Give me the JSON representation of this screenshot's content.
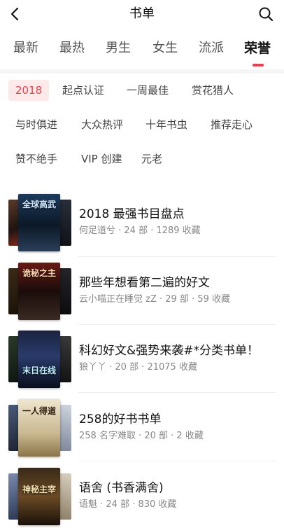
{
  "header": {
    "title": "书单",
    "back_icon": "chevron-left-icon",
    "search_icon": "search-icon"
  },
  "tabs": [
    {
      "label": "最新",
      "active": false
    },
    {
      "label": "最热",
      "active": false
    },
    {
      "label": "男生",
      "active": false
    },
    {
      "label": "女生",
      "active": false
    },
    {
      "label": "流派",
      "active": false
    },
    {
      "label": "荣誉",
      "active": true
    }
  ],
  "accent_color": "#e8414b",
  "filters": [
    {
      "label": "2018",
      "active": true
    },
    {
      "label": "起点认证",
      "active": false
    },
    {
      "label": "一周最佳",
      "active": false
    },
    {
      "label": "赏花猎人",
      "active": false
    },
    {
      "label": "与时俱进",
      "active": false
    },
    {
      "label": "大众热评",
      "active": false
    },
    {
      "label": "十年书虫",
      "active": false
    },
    {
      "label": "推荐走心",
      "active": false
    },
    {
      "label": "赞不绝手",
      "active": false
    },
    {
      "label": "VIP 创建",
      "active": false
    },
    {
      "label": "元老",
      "active": false
    }
  ],
  "booklists": [
    {
      "title": "2018 最强书目盘点",
      "meta": "何足道兮 · 24 部 · 1289 收藏",
      "cover_text": "全球高武"
    },
    {
      "title": "那些年想看第二遍的好文",
      "meta": "云小喵正在睡觉 zZ · 29 部 · 59 收藏",
      "cover_text": "诡秘之主"
    },
    {
      "title": "科幻好文&强势来袭#*分类书单！",
      "meta": "狼丫丫 · 20 部 · 21075 收藏",
      "cover_text": "末日在线"
    },
    {
      "title": "258的好书书单",
      "meta": "258 名字难取 · 20 部 · 2 收藏",
      "cover_text": "一人得道"
    },
    {
      "title": "语舍 (书香满舍)",
      "meta": "语魁 · 24 部 · 830 收藏",
      "cover_text": "神秘主宰"
    }
  ]
}
